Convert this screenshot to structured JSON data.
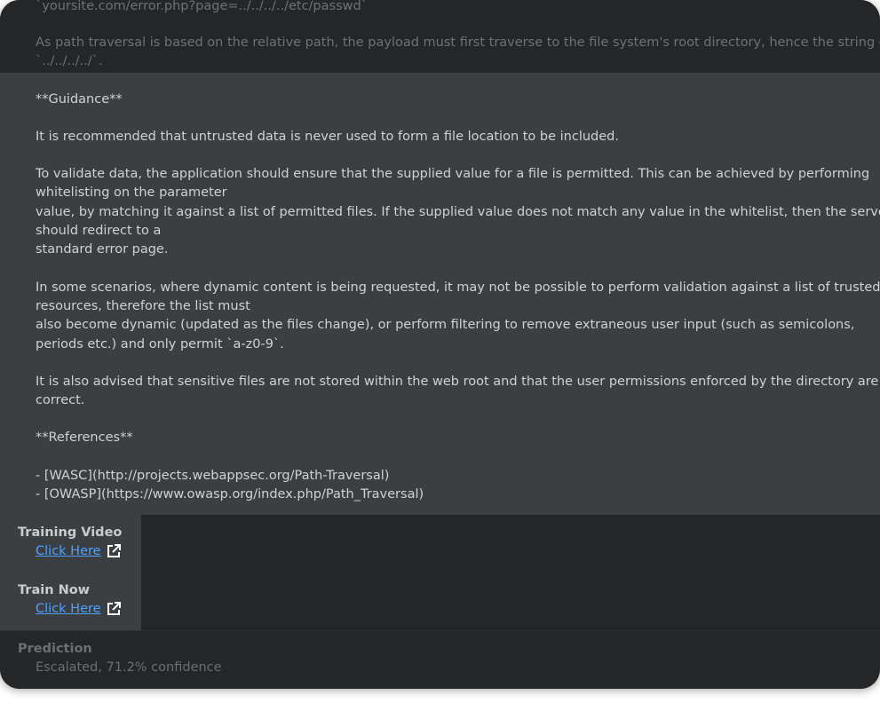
{
  "top": {
    "lines": [
      "`yoursite.com/error.php?page=../../../../etc/passwd`",
      "As path traversal is based on the relative path, the payload must first traverse to the file system's root directory, hence the string of",
      "`../../../../`."
    ]
  },
  "guidance": {
    "lines": [
      "**Guidance**",
      "It is recommended that untrusted data is never used to form a file location to be included.",
      "To validate data, the application should ensure that the supplied value for a file is permitted. This can be achieved by performing",
      "whitelisting on the parameter",
      "value, by matching it against a list of permitted files. If the supplied value does not match any value in the whitelist, then the server",
      "should redirect to a",
      "standard error page.",
      "In some scenarios, where dynamic content is being requested, it may not be possible to perform validation against a list of trusted",
      "resources, therefore the list must",
      "also become dynamic (updated as the files change), or perform filtering to remove extraneous user input (such as semicolons,",
      "periods etc.) and only permit `a-z0-9`.",
      "It is also advised that sensitive files are not stored within the web root and that the user permissions enforced by the directory are",
      "correct.",
      "**References**",
      "- [WASC](http://projects.webappsec.org/Path-Traversal)",
      "- [OWASP](https://www.owasp.org/index.php/Path_Traversal)"
    ]
  },
  "training_video": {
    "title": "Training Video",
    "link_label": "Click Here",
    "icon": "external-link-icon"
  },
  "train_now": {
    "title": "Train Now",
    "link_label": "Click Here",
    "icon": "external-link-icon"
  },
  "prediction": {
    "title": "Prediction",
    "text": "Escalated, 71.2% confidence"
  },
  "colors": {
    "link": "#4ea1ff",
    "panel": "#3b3f42",
    "background": "#242628"
  }
}
